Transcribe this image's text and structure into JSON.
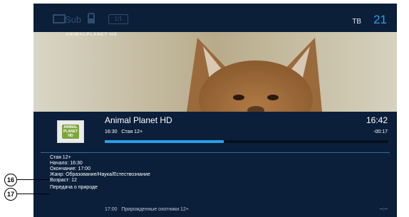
{
  "status_bar": {
    "sub_label": "Sub",
    "audio_label": "1/1",
    "tv_label": "ТВ",
    "channel_number": "21"
  },
  "video": {
    "watermark": "ANIMALPLANET HD"
  },
  "channel": {
    "name": "Animal Planet HD",
    "logo_text": "ANIMAL PLANET HD",
    "clock": "16:42"
  },
  "current_program": {
    "start": "16:30",
    "title": "Стая 12+",
    "remaining": "-00:17",
    "progress_fraction": 0.42
  },
  "details": {
    "title": "Стая 12+",
    "start": "Начало: 16:30",
    "end": "Окончание: 17:00",
    "genre": "Жанр: Образование/Наука/Естествознание",
    "age": "Возраст: 12",
    "description": "Передача о природе"
  },
  "next_program": {
    "time": "17:00",
    "title": "Прирожденные охотники 12+",
    "dash": "--:--"
  },
  "callouts": [
    "16",
    "17"
  ],
  "colors": {
    "background": "#0b1f3a",
    "accent": "#2a9fe6"
  }
}
